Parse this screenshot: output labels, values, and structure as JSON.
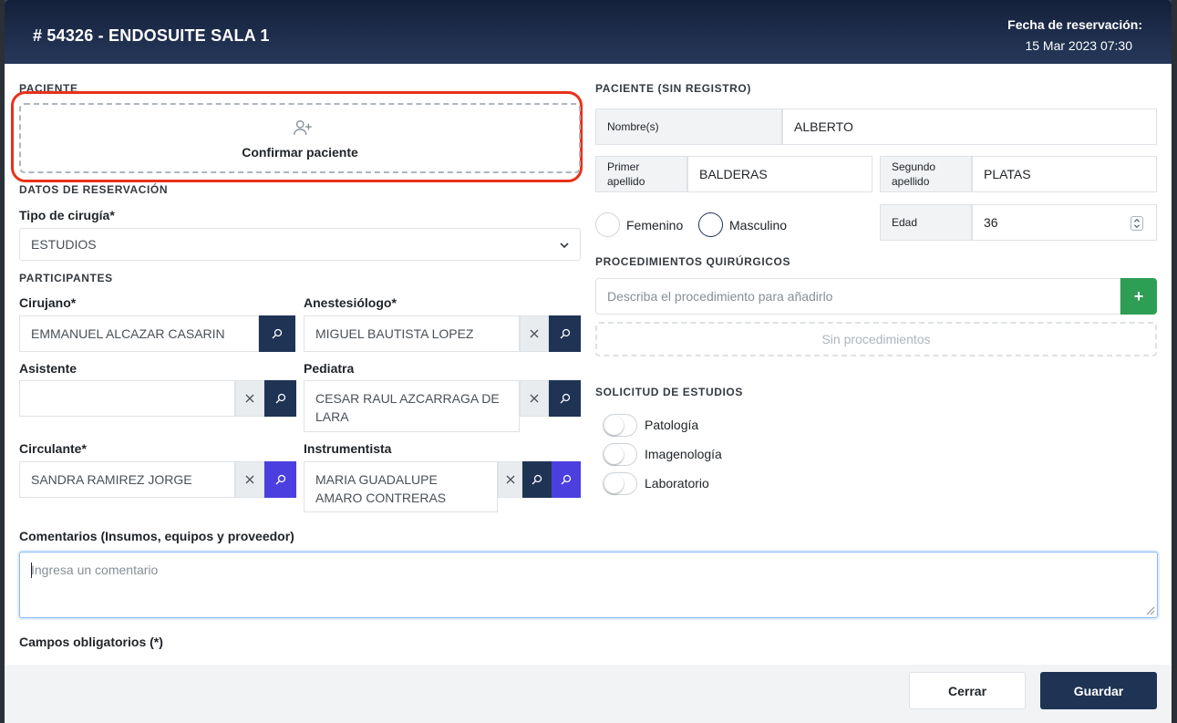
{
  "header": {
    "title": "# 54326 - ENDOSUITE SALA 1",
    "date_label": "Fecha de reservación:",
    "date_value": "15 Mar 2023 07:30"
  },
  "patient": {
    "section_label": "PACIENTE",
    "confirm_label": "Confirmar paciente"
  },
  "reservation": {
    "section_label": "DATOS DE RESERVACIÓN",
    "surgery_type_label": "Tipo de cirugía*",
    "surgery_type_value": "ESTUDIOS"
  },
  "participants": {
    "section_label": "PARTICIPANTES",
    "surgeon_label": "Cirujano*",
    "surgeon_value": "EMMANUEL ALCAZAR CASARIN",
    "anesthesiologist_label": "Anestesiólogo*",
    "anesthesiologist_value": "MIGUEL BAUTISTA LOPEZ",
    "assistant_label": "Asistente",
    "assistant_value": "",
    "pediatrician_label": "Pediatra",
    "pediatrician_value": "CESAR RAUL AZCARRAGA DE LARA",
    "circulating_label": "Circulante*",
    "circulating_value": "SANDRA RAMIREZ JORGE",
    "instrumentist_label": "Instrumentista",
    "instrumentist_value": "MARIA GUADALUPE AMARO CONTRERAS"
  },
  "unregistered": {
    "section_label": "PACIENTE (SIN REGISTRO)",
    "names_label": "Nombre(s)",
    "names_value": "ALBERTO",
    "first_surname_label": "Primer apellido",
    "first_surname_value": "BALDERAS",
    "second_surname_label": "Segundo apellido",
    "second_surname_value": "PLATAS",
    "female_label": "Femenino",
    "male_label": "Masculino",
    "age_label": "Edad",
    "age_value": "36"
  },
  "procedures": {
    "section_label": "PROCEDIMIENTOS QUIRÚRGICOS",
    "placeholder": "Describa el procedimiento para añadirlo",
    "add_label": "+",
    "empty_label": "Sin procedimientos"
  },
  "studies": {
    "section_label": "SOLICITUD DE ESTUDIOS",
    "items": [
      "Patología",
      "Imagenología",
      "Laboratorio"
    ]
  },
  "comments": {
    "label": "Comentarios (Insumos, equipos y proveedor)",
    "placeholder": "Ingresa un comentario"
  },
  "required_note": "Campos obligatorios (*)",
  "footer": {
    "close_label": "Cerrar",
    "save_label": "Guardar"
  }
}
